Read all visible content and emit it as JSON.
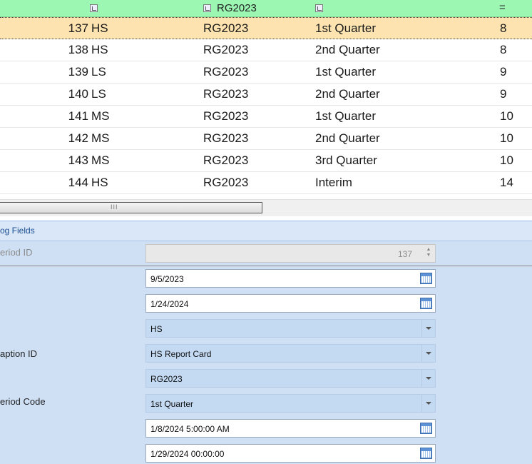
{
  "grid": {
    "filter": {
      "code_value": "RG2023",
      "grade_op": "="
    },
    "rows": [
      {
        "id": "137",
        "school": "HS",
        "code": "RG2023",
        "period": "1st Quarter",
        "grade": "8",
        "selected": true
      },
      {
        "id": "138",
        "school": "HS",
        "code": "RG2023",
        "period": "2nd Quarter",
        "grade": "8"
      },
      {
        "id": "139",
        "school": "LS",
        "code": "RG2023",
        "period": "1st Quarter",
        "grade": "9"
      },
      {
        "id": "140",
        "school": "LS",
        "code": "RG2023",
        "period": "2nd Quarter",
        "grade": "9"
      },
      {
        "id": "141",
        "school": "MS",
        "code": "RG2023",
        "period": "1st Quarter",
        "grade": "10"
      },
      {
        "id": "142",
        "school": "MS",
        "code": "RG2023",
        "period": "2nd Quarter",
        "grade": "10"
      },
      {
        "id": "143",
        "school": "MS",
        "code": "RG2023",
        "period": "3rd Quarter",
        "grade": "10"
      },
      {
        "id": "144",
        "school": "HS",
        "code": "RG2023",
        "period": "Interim",
        "grade": "14"
      }
    ],
    "scroll_grip": "III"
  },
  "form": {
    "group_title": "og Fields",
    "labels": {
      "period_id": "eriod ID",
      "caption_id": "aption ID",
      "period_code": "eriod Code"
    },
    "values": {
      "period_id": "137",
      "start_date": "9/5/2023",
      "end_date": "1/24/2024",
      "school": "HS",
      "caption": "HS Report Card",
      "code": "RG2023",
      "period_code": "1st Quarter",
      "date_time_1": "1/8/2024 5:00:00 AM",
      "date_time_2": "1/29/2024 00:00:00"
    }
  },
  "colors": {
    "filter_row": "#9cf7b3",
    "selected_row": "#fce3b0",
    "form_bg": "#cfe0f5"
  }
}
